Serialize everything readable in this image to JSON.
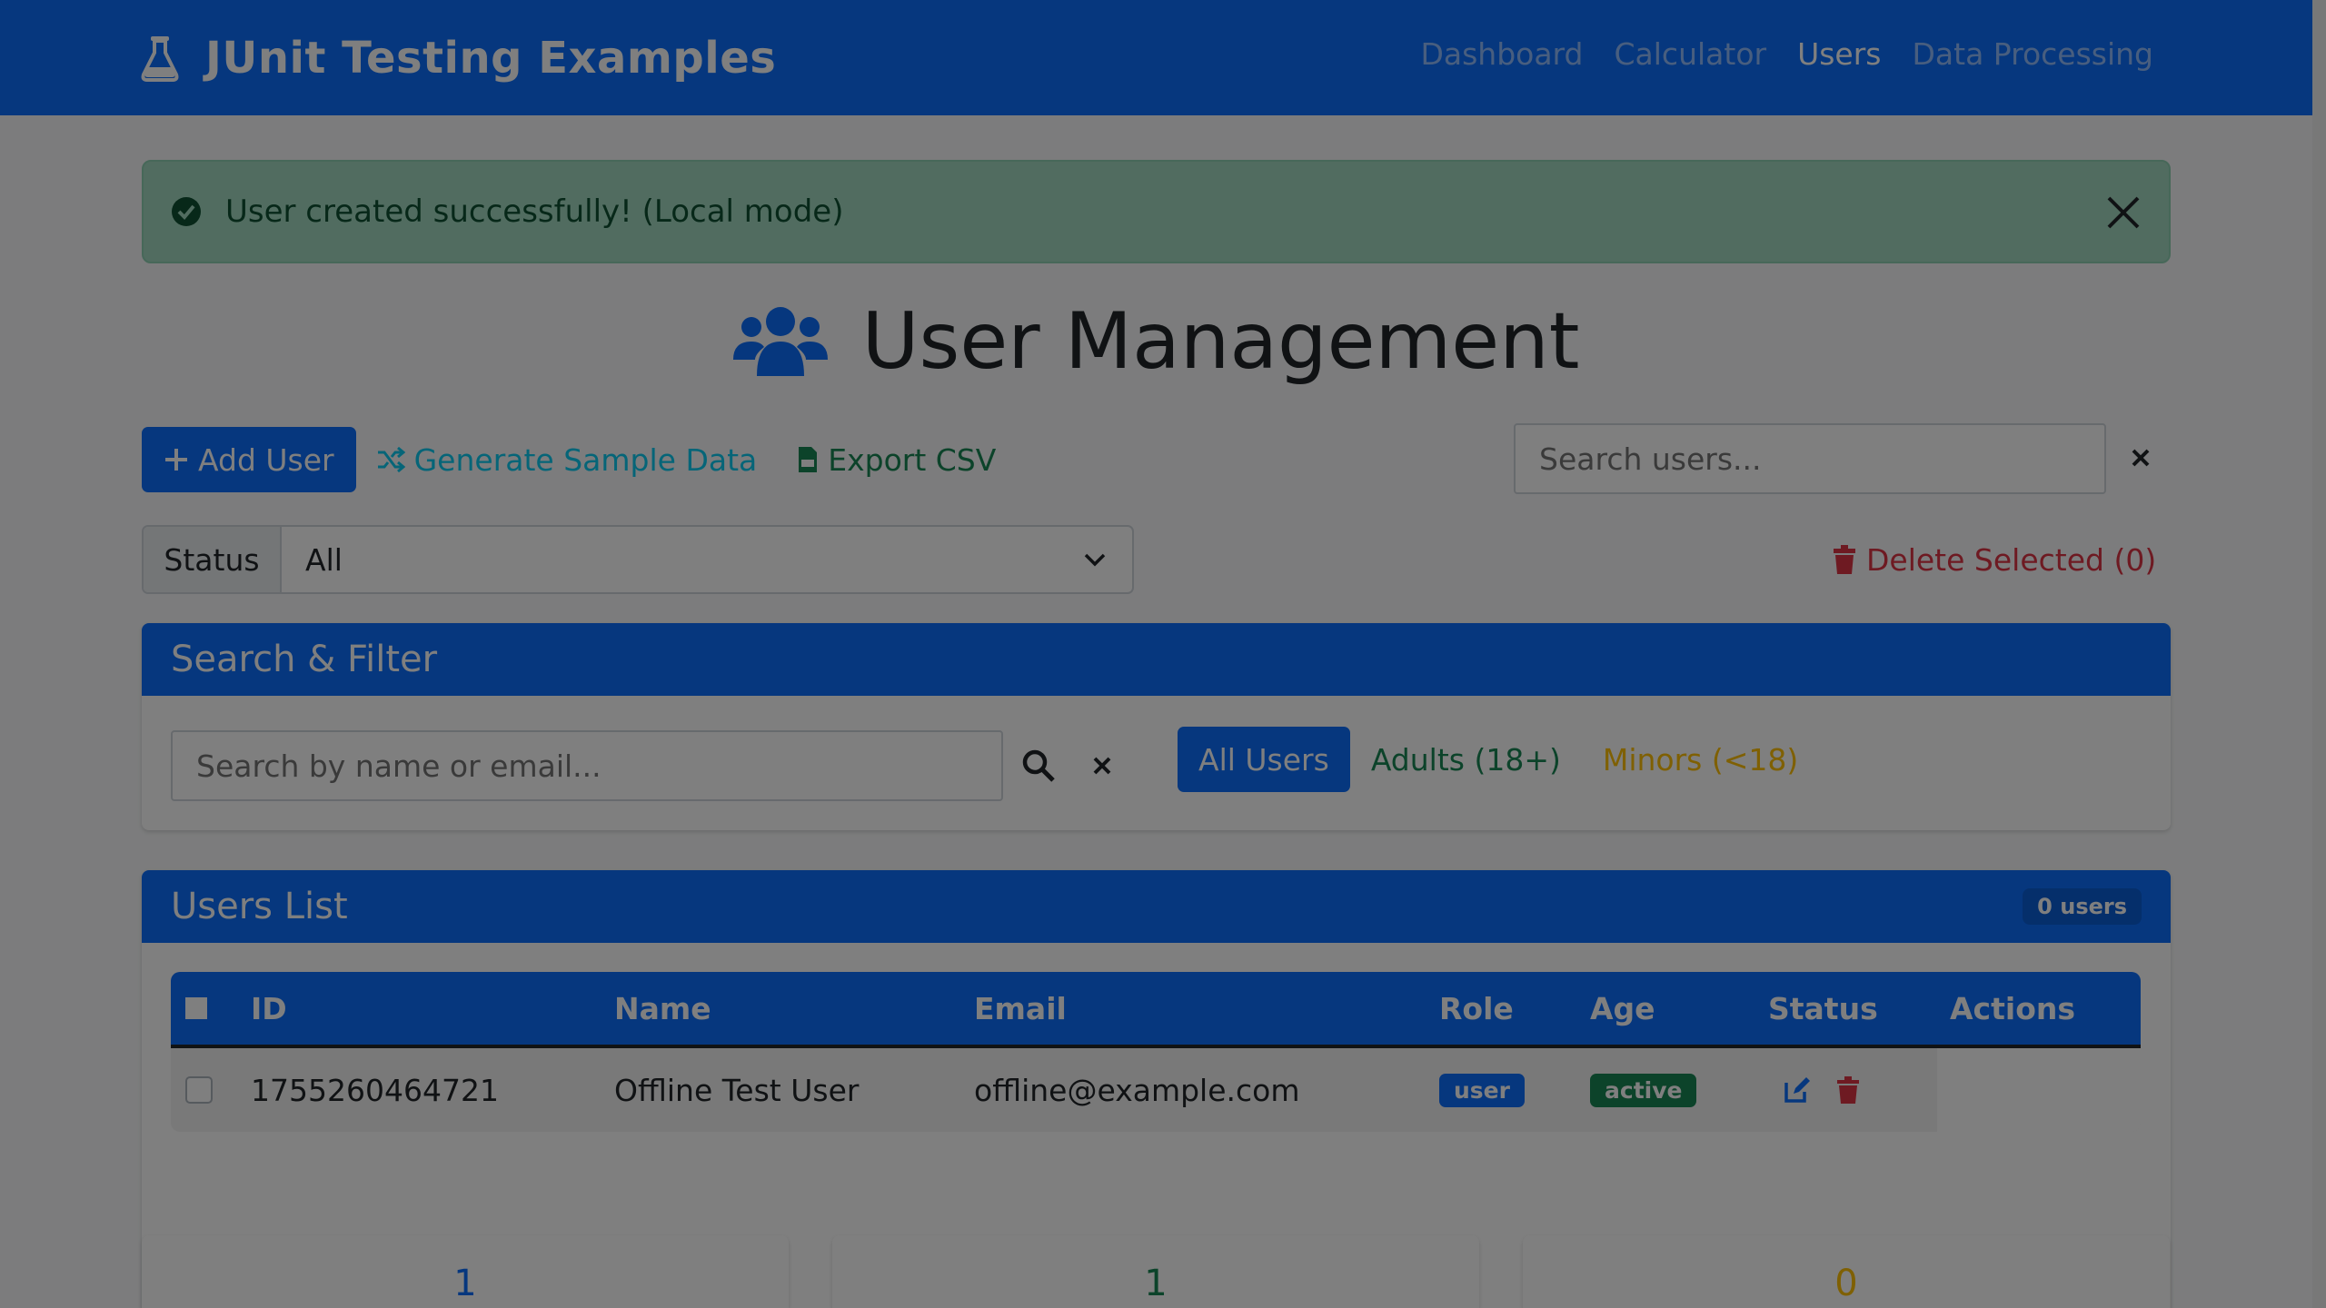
{
  "navbar": {
    "brand": "JUnit Testing Examples",
    "links": [
      "Dashboard",
      "Calculator",
      "Users",
      "Data Processing"
    ],
    "active_link": "Users"
  },
  "alert": {
    "message": "User created successfully! (Local mode)"
  },
  "page": {
    "title": "User Management"
  },
  "toolbar": {
    "add_user": "Add User",
    "generate_sample": "Generate Sample Data",
    "export_csv": "Export CSV",
    "search_placeholder": "Search users..."
  },
  "status_filter": {
    "label": "Status",
    "selected": "All"
  },
  "delete_selected": "Delete Selected (0)",
  "search_filter": {
    "title": "Search & Filter",
    "placeholder": "Search by name or email...",
    "segments": [
      "All Users",
      "Adults (18+)",
      "Minors (<18)"
    ]
  },
  "users_list": {
    "title": "Users List",
    "count_badge": "0 users",
    "columns": [
      "ID",
      "Name",
      "Email",
      "Role",
      "Age",
      "Status",
      "Actions"
    ],
    "rows": [
      {
        "id": "1755260464721",
        "name": "Offline Test User",
        "email": "offline@example.com",
        "role": "user",
        "status": "active"
      }
    ]
  },
  "stats": [
    "1",
    "1",
    "0"
  ],
  "colors": {
    "primary": "#0d6efd",
    "success": "#198754",
    "warning": "#ffc107",
    "danger": "#dc3545",
    "info": "#0dcaf0"
  }
}
